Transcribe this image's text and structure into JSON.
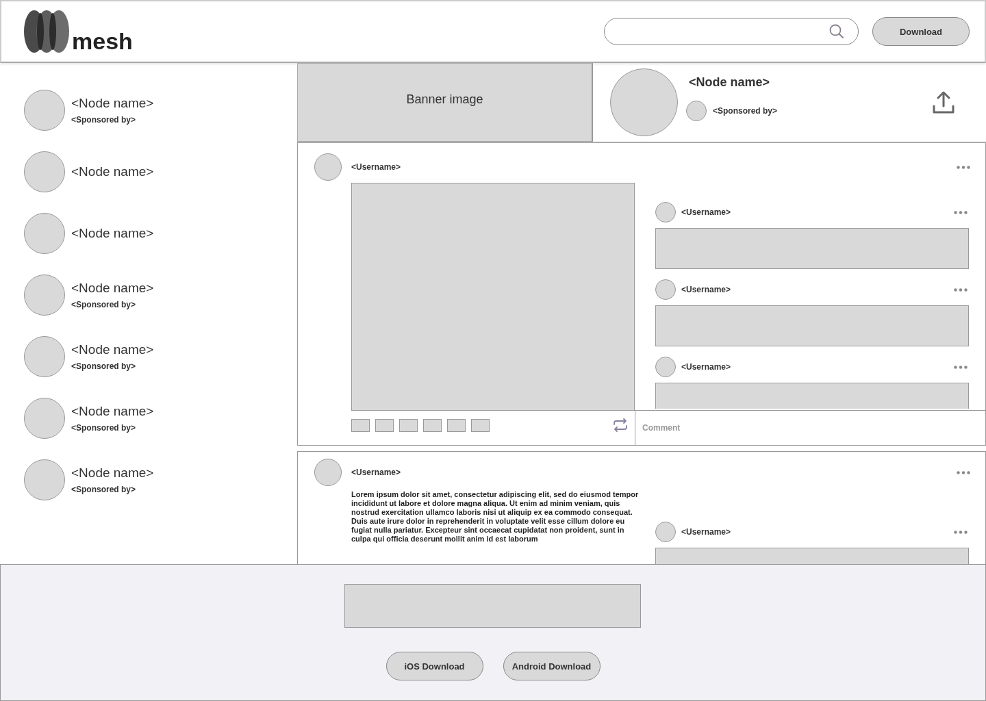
{
  "header": {
    "logo": "mesh",
    "download": "Download"
  },
  "sidebar": {
    "items": [
      {
        "name": "<Node name>",
        "sponsor": "<Sponsored by>"
      },
      {
        "name": "<Node name>"
      },
      {
        "name": "<Node name>"
      },
      {
        "name": "<Node name>",
        "sponsor": "<Sponsored by>"
      },
      {
        "name": "<Node name>",
        "sponsor": "<Sponsored by>"
      },
      {
        "name": "<Node name>",
        "sponsor": "<Sponsored by>"
      },
      {
        "name": "<Node name>",
        "sponsor": "<Sponsored by>"
      }
    ]
  },
  "banner": {
    "label": "Banner image"
  },
  "profile": {
    "name": "<Node name>",
    "sponsor": "<Sponsored by>"
  },
  "posts": [
    {
      "kind": "media",
      "username": "<Username>",
      "comment_placeholder": "Comment",
      "comments": [
        {
          "username": "<Username>"
        },
        {
          "username": "<Username>"
        },
        {
          "username": "<Username>"
        }
      ]
    },
    {
      "kind": "text",
      "username": "<Username>",
      "text": "Lorem ipsum dolor sit amet, consectetur adipiscing elit, sed do eiusmod tempor incididunt ut labore et dolore magna aliqua. Ut enim ad minim veniam, quis nostrud exercitation ullamco laboris nisi ut aliquip ex ea commodo consequat. Duis aute irure dolor in reprehenderit in voluptate velit esse cillum dolore eu fugiat nulla pariatur. Excepteur sint occaecat cupidatat non proident, sunt in culpa qui officia deserunt mollit anim id est laborum",
      "comments": [
        {
          "username": "<Username>"
        }
      ]
    }
  ],
  "footer": {
    "buttons": [
      "iOS Download",
      "Android Download"
    ]
  }
}
